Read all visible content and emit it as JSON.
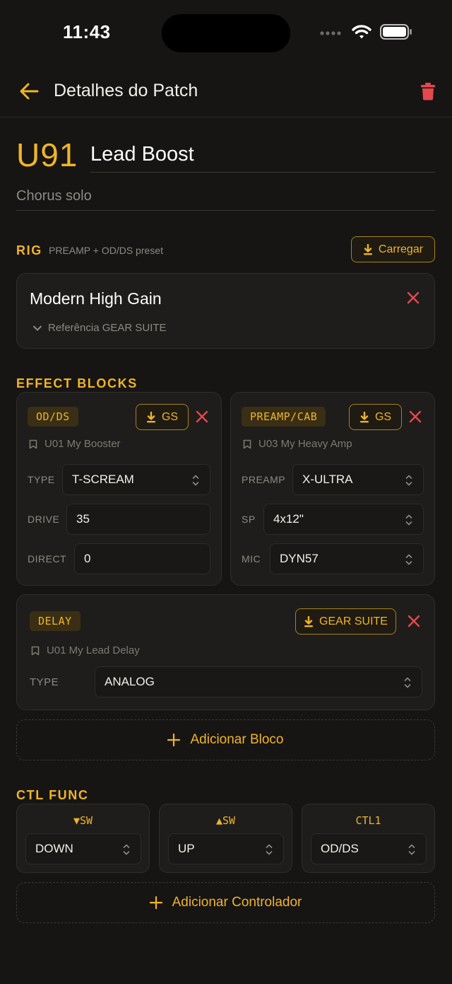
{
  "status": {
    "time": "11:43"
  },
  "header": {
    "title": "Detalhes do Patch"
  },
  "patch": {
    "id": "U91",
    "name": "Lead Boost",
    "description": "Chorus solo"
  },
  "rig": {
    "section_title": "RIG",
    "section_subtitle": "PREAMP + OD/DS preset",
    "load_button": "Carregar",
    "name": "Modern High Gain",
    "reference": "Referência GEAR SUITE"
  },
  "effects": {
    "section_title": "EFFECT BLOCKS",
    "blocks": [
      {
        "tag": "OD/DS",
        "gs_button": "GS",
        "preset": "U01 My Booster",
        "fields": [
          {
            "label": "TYPE",
            "value": "T-SCREAM"
          },
          {
            "label": "DRIVE",
            "value": "35"
          },
          {
            "label": "DIRECT",
            "value": "0"
          }
        ]
      },
      {
        "tag": "PREAMP/CAB",
        "gs_button": "GS",
        "preset": "U03 My Heavy Amp",
        "fields": [
          {
            "label": "PREAMP",
            "value": "X-ULTRA"
          },
          {
            "label": "SP",
            "value": "4x12\""
          },
          {
            "label": "MIC",
            "value": "DYN57"
          }
        ]
      },
      {
        "tag": "DELAY",
        "gs_button": "GEAR SUITE",
        "preset": "U01 My Lead Delay",
        "fields": [
          {
            "label": "TYPE",
            "value": "ANALOG"
          }
        ]
      }
    ],
    "add_block": "Adicionar Bloco"
  },
  "ctl": {
    "section_title": "CTL FUNC",
    "items": [
      {
        "label": "▼SW",
        "value": "DOWN"
      },
      {
        "label": "▲SW",
        "value": "UP"
      },
      {
        "label": "CTL1",
        "value": "OD/DS"
      }
    ],
    "add_controller": "Adicionar Controlador"
  },
  "colors": {
    "accent": "#f0b429",
    "danger": "#e5484d",
    "background": "#161514",
    "card": "#1e1d1b"
  }
}
